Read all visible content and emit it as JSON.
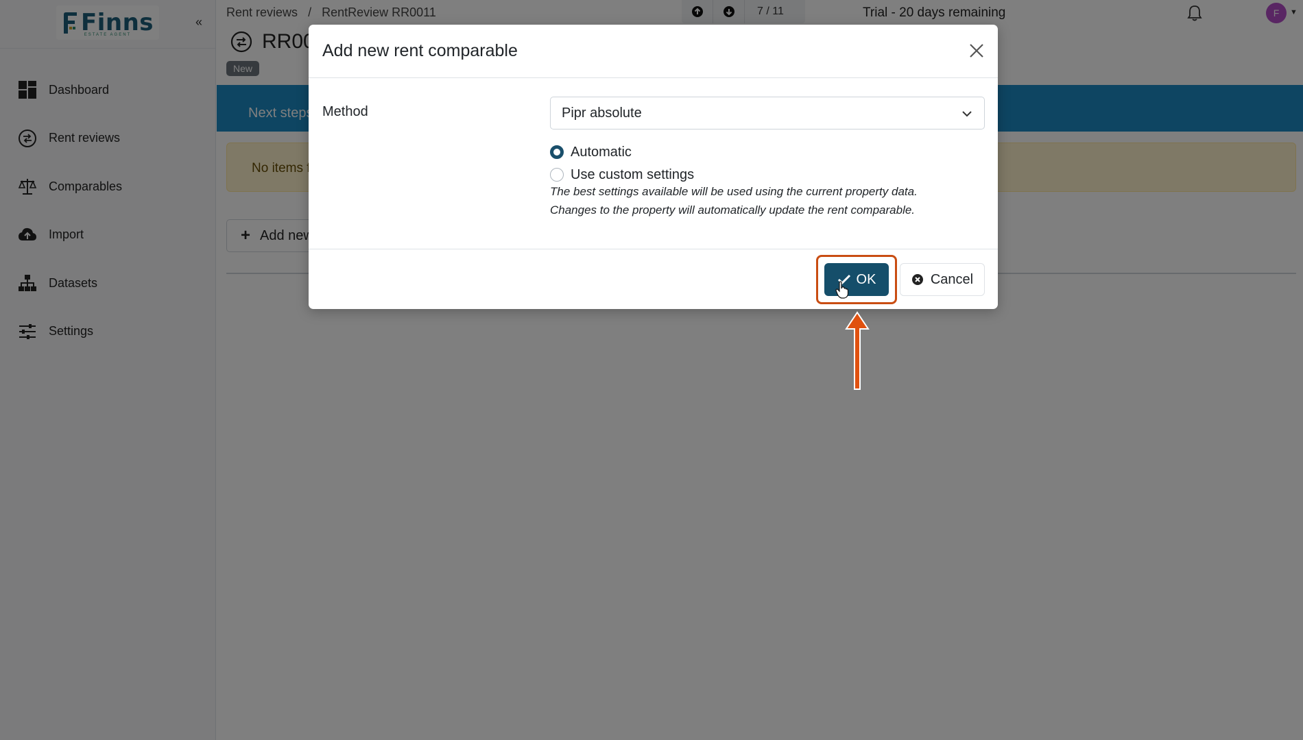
{
  "app": {
    "logo_text": "Finns",
    "logo_sub": "ESTATE AGENT",
    "collapse_glyph": "«"
  },
  "sidebar": {
    "items": [
      {
        "label": "Dashboard",
        "icon": "dashboard-icon"
      },
      {
        "label": "Rent reviews",
        "icon": "rent-reviews-icon"
      },
      {
        "label": "Comparables",
        "icon": "scales-icon"
      },
      {
        "label": "Import",
        "icon": "cloud-upload-icon"
      },
      {
        "label": "Datasets",
        "icon": "sitemap-icon"
      },
      {
        "label": "Settings",
        "icon": "sliders-icon"
      }
    ]
  },
  "header": {
    "breadcrumb": [
      "Rent reviews",
      "RentReview RR0011"
    ],
    "breadcrumb_sep": "/",
    "pager_text": "7 / 11",
    "trial_text": "Trial - 20 days remaining",
    "avatar_initial": "F"
  },
  "page": {
    "title": "RR0011",
    "status_badge": "New",
    "steps_label": "Next steps",
    "alert_text": "No items found",
    "add_button_label": "Add new"
  },
  "modal": {
    "title": "Add new rent comparable",
    "method_label": "Method",
    "method_value": "Pipr absolute",
    "radio_options": [
      {
        "label": "Automatic",
        "checked": true
      },
      {
        "label": "Use custom settings",
        "checked": false
      }
    ],
    "help_lines": [
      "The best settings available will be used using the current property data.",
      "Changes to the property will automatically update the rent comparable."
    ],
    "ok_label": "OK",
    "cancel_label": "Cancel"
  },
  "colors": {
    "primary": "#154e6a",
    "steps_bar": "#1d8bc4",
    "highlight": "#c94d12",
    "alert_bg": "#fff3cd",
    "avatar": "#b24cc7"
  }
}
